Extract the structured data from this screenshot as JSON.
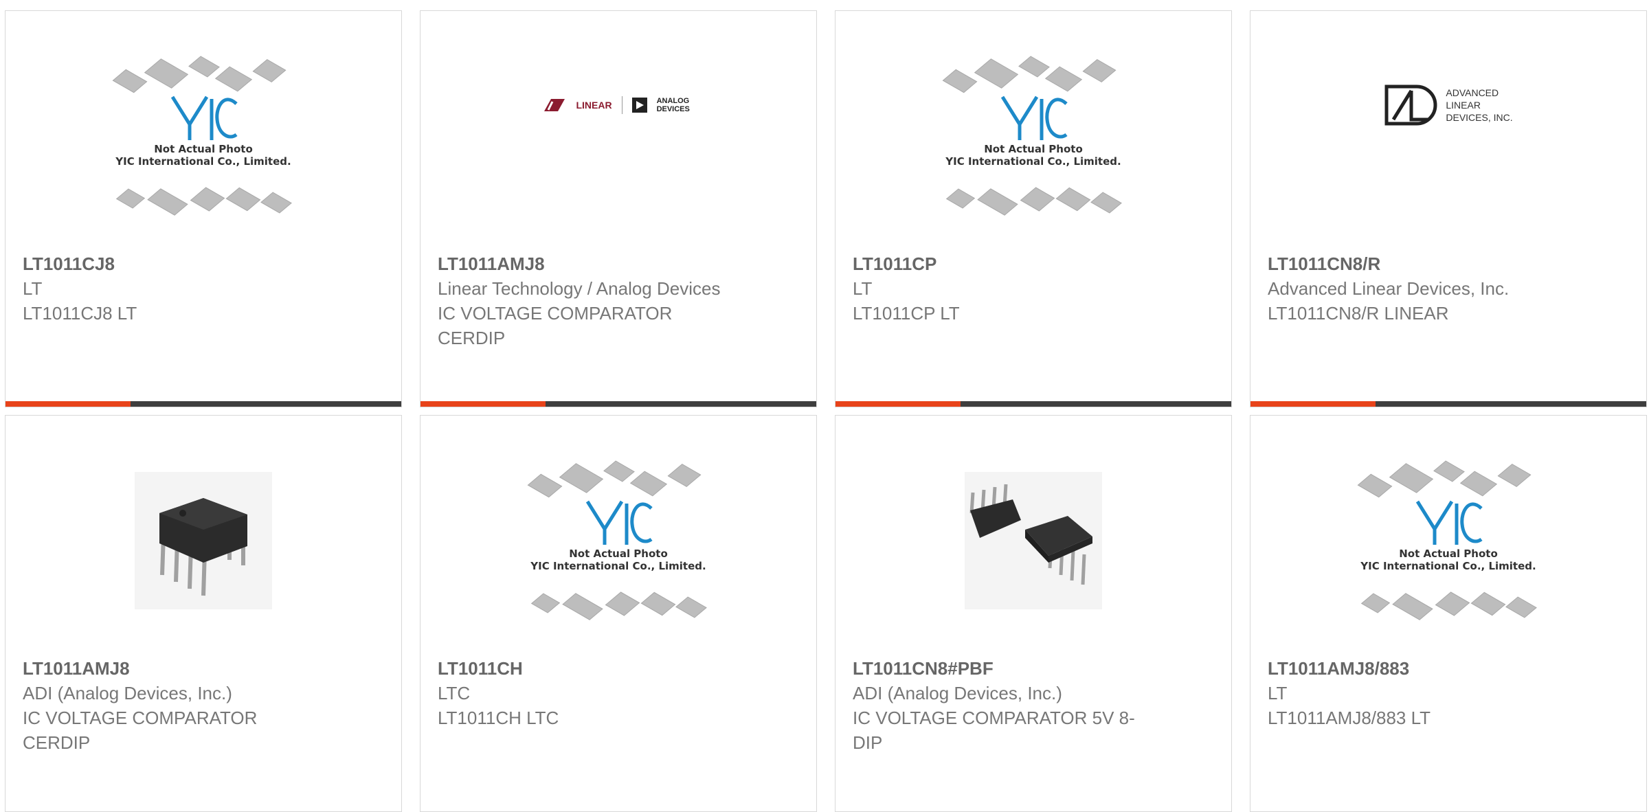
{
  "colors": {
    "accent": "#e8431a",
    "bar": "#3e3e3e",
    "border": "#d8d8d8",
    "part": "#666666",
    "text": "#777777"
  },
  "placeholder": {
    "line1": "Not Actual Photo",
    "line2": "YIC International Co., Limited.",
    "brand": "YIC"
  },
  "products": [
    {
      "part": "LT1011CJ8",
      "mfr": "LT",
      "desc": "LT1011CJ8 LT",
      "image": "yic-placeholder"
    },
    {
      "part": "LT1011AMJ8",
      "mfr": "Linear Technology / Analog Devices",
      "desc": "IC VOLTAGE COMPARATOR CERDIP",
      "image": "linear-analog-logo",
      "logo_text_a": "LINEAR",
      "logo_text_b": "ANALOG DEVICES"
    },
    {
      "part": "LT1011CP",
      "mfr": "LT",
      "desc": "LT1011CP LT",
      "image": "yic-placeholder"
    },
    {
      "part": "LT1011CN8/R",
      "mfr": "Advanced Linear Devices, Inc.",
      "desc": "LT1011CN8/R LINEAR",
      "image": "ald-logo",
      "logo_lines": [
        "ADVANCED",
        "LINEAR",
        "DEVICES, INC."
      ]
    },
    {
      "part": "LT1011AMJ8",
      "mfr": "ADI (Analog Devices, Inc.)",
      "desc": "IC VOLTAGE COMPARATOR CERDIP",
      "image": "dip8-chip-photo"
    },
    {
      "part": "LT1011CH",
      "mfr": "LTC",
      "desc": "LT1011CH LTC",
      "image": "yic-placeholder"
    },
    {
      "part": "LT1011CN8#PBF",
      "mfr": "ADI (Analog Devices, Inc.)",
      "desc": "IC VOLTAGE COMPARATOR 5V 8-DIP",
      "image": "dual-dip-chip-photo"
    },
    {
      "part": "LT1011AMJ8/883",
      "mfr": "LT",
      "desc": "LT1011AMJ8/883 LT",
      "image": "yic-placeholder"
    }
  ]
}
